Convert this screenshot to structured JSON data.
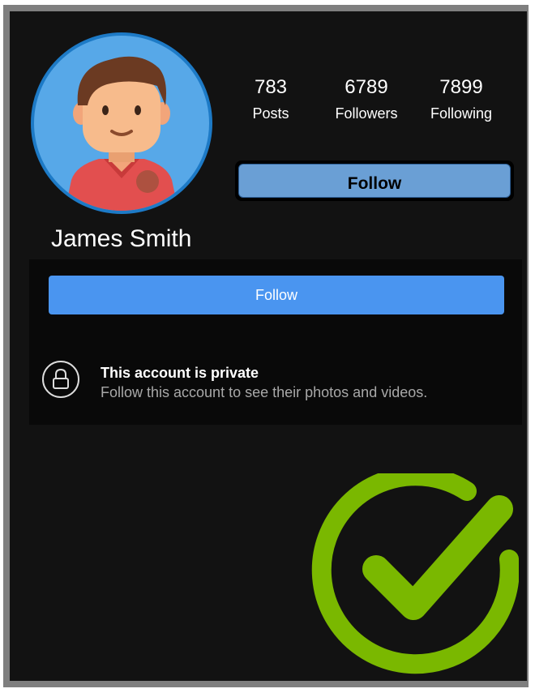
{
  "profile": {
    "name": "James Smith"
  },
  "stats": [
    {
      "value": "783",
      "label": "Posts"
    },
    {
      "value": "6789",
      "label": "Followers"
    },
    {
      "value": "7899",
      "label": "Following"
    }
  ],
  "buttons": {
    "follow_top": "Follow",
    "follow_main": "Follow"
  },
  "private_notice": {
    "title": "This account is private",
    "subtitle": "Follow this account to see their photos and videos."
  },
  "icons": {
    "avatar": "avatar-illustration",
    "lock": "lock-icon",
    "check": "checkmark-icon"
  },
  "colors": {
    "screen_bg": "#121212",
    "follow_blue": "#4a95f0",
    "check_green": "#7ab800"
  }
}
